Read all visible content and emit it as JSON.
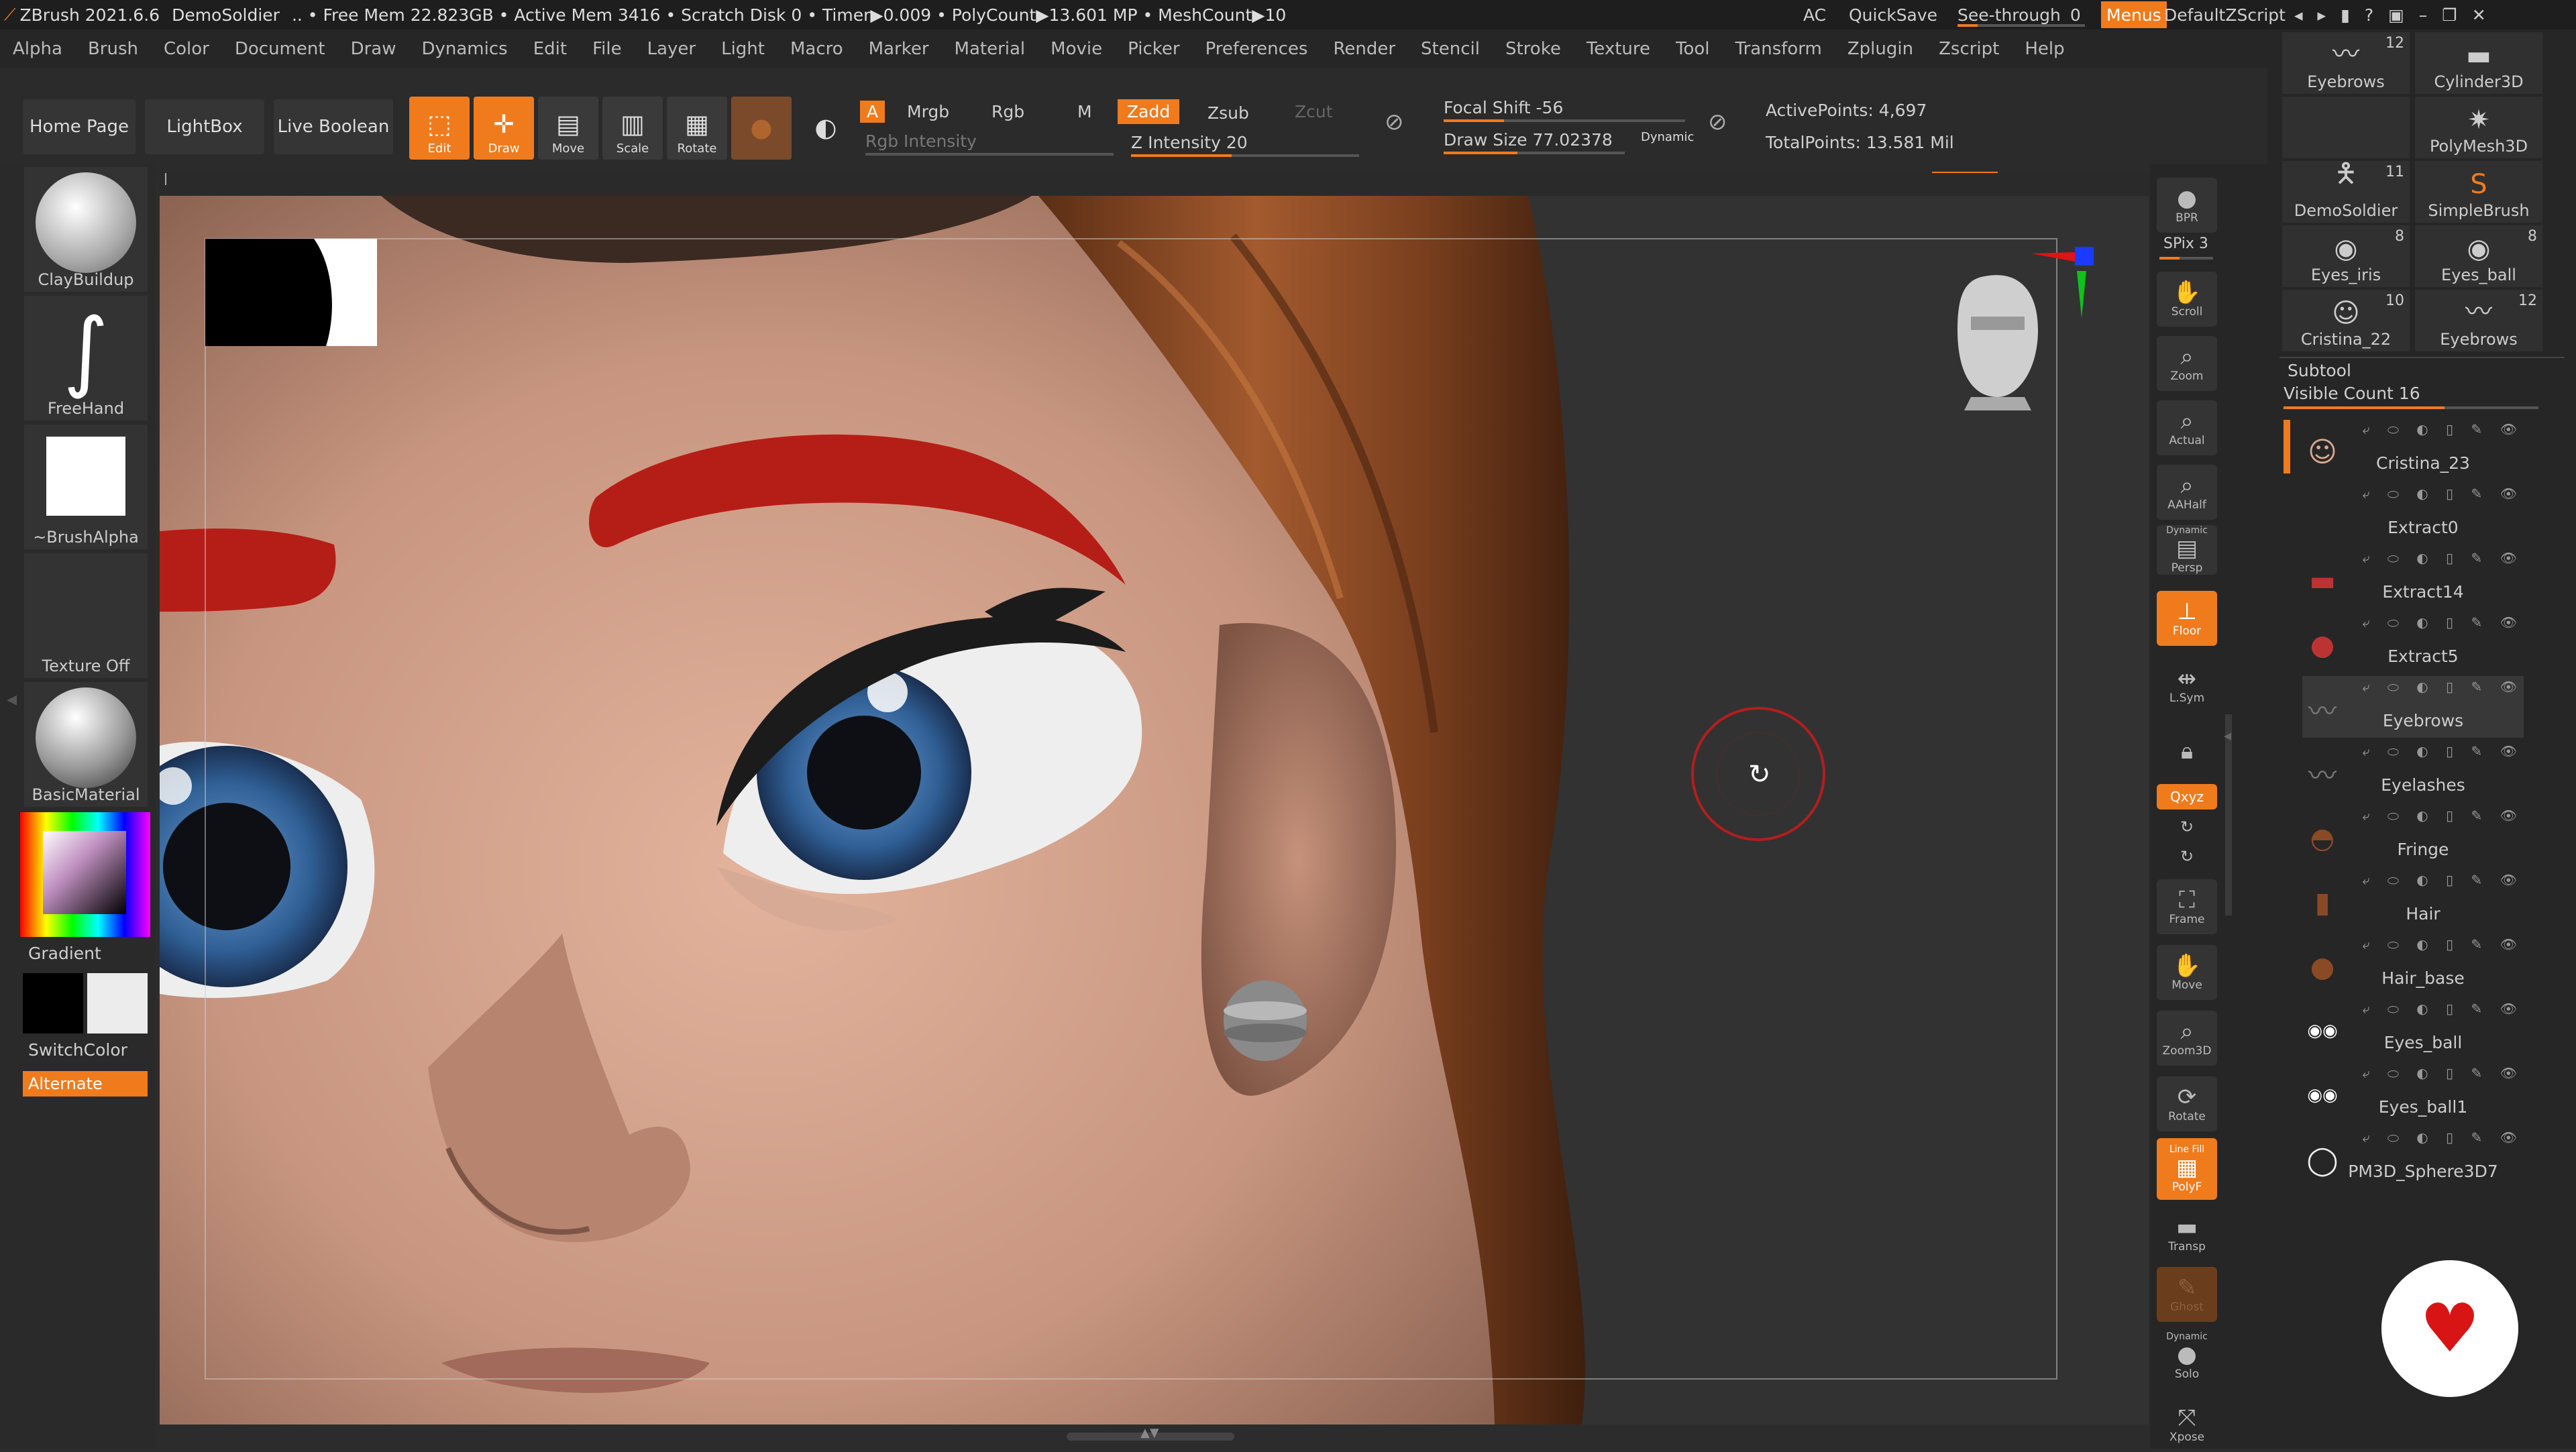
{
  "titlebar": {
    "app": "ZBrush 2021.6.6",
    "project": "DemoSoldier",
    "stats": ".. • Free Mem 22.823GB • Active Mem 3416 • Scratch Disk 0 • Timer▶0.009 • PolyCount▶13.601 MP • MeshCount▶10",
    "ac": "AC",
    "quicksave": "QuickSave",
    "see_through": "See-through",
    "see_through_value": "0",
    "menus": "Menus",
    "script": "DefaultZScript"
  },
  "menubar": [
    "Alpha",
    "Brush",
    "Color",
    "Document",
    "Draw",
    "Dynamics",
    "Edit",
    "File",
    "Layer",
    "Light",
    "Macro",
    "Marker",
    "Material",
    "Movie",
    "Picker",
    "Preferences",
    "Render",
    "Stencil",
    "Stroke",
    "Texture",
    "Tool",
    "Transform",
    "Zplugin",
    "Zscript",
    "Help"
  ],
  "shelf": {
    "home": "Home Page",
    "lightbox": "LightBox",
    "live_boolean": "Live Boolean",
    "edit": "Edit",
    "draw": "Draw",
    "move": "Move",
    "scale": "Scale",
    "rotate": "Rotate",
    "a": "A",
    "mrgb": "Mrgb",
    "rgb": "Rgb",
    "m": "M",
    "zadd": "Zadd",
    "zsub": "Zsub",
    "zcut": "Zcut",
    "rgb_intensity": "Rgb Intensity",
    "z_intensity": "Z Intensity 20",
    "focal_shift": "Focal Shift -56",
    "draw_size": "Draw Size 77.02378",
    "dynamic": "Dynamic",
    "active_points": "ActivePoints: 4,697",
    "total_points": "TotalPoints: 13.581 Mil"
  },
  "lefttray": {
    "brush": "ClayBuildup",
    "stroke": "FreeHand",
    "alpha": "~BrushAlpha",
    "texture": "Texture Off",
    "material": "BasicMaterial",
    "gradient": "Gradient",
    "switchcolor": "SwitchColor",
    "alternate": "Alternate"
  },
  "rightshelf": {
    "bpr": "BPR",
    "spix": "SPix 3",
    "scroll": "Scroll",
    "zoom": "Zoom",
    "actual": "Actual",
    "aahalf": "AAHalf",
    "dynamic_persp_top": "Dynamic",
    "persp": "Persp",
    "floor": "Floor",
    "lsym": "L.Sym",
    "xyz": "Qxyz",
    "frame": "Frame",
    "move": "Move",
    "zoom3d": "Zoom3D",
    "rotate": "Rotate",
    "line_fill": "Line Fill",
    "polyf": "PolyF",
    "transp": "Transp",
    "ghost": "Ghost",
    "dynamic_solo": "Dynamic",
    "solo": "Solo",
    "xpose": "Xpose"
  },
  "tools": [
    {
      "name": "Eyebrows",
      "count": "12"
    },
    {
      "name": "Cylinder3D",
      "count": ""
    },
    {
      "name": "",
      "count": ""
    },
    {
      "name": "PolyMesh3D",
      "count": ""
    },
    {
      "name": "DemoSoldier",
      "count": "11"
    },
    {
      "name": "SimpleBrush",
      "count": ""
    },
    {
      "name": "Eyes_iris",
      "count": "8"
    },
    {
      "name": "Eyes_ball",
      "count": "8"
    },
    {
      "name": "Cristina_22",
      "count": "10"
    },
    {
      "name": "Eyebrows",
      "count": "12"
    }
  ],
  "subtool": {
    "title": "Subtool",
    "visible_count": "Visible Count 16",
    "items": [
      "Cristina_23",
      "Extract0",
      "Extract14",
      "Extract5",
      "Eyebrows",
      "Eyelashes",
      "Fringe",
      "Hair",
      "Hair_base",
      "Eyes_ball",
      "Eyes_ball1",
      "PM3D_Sphere3D7"
    ]
  },
  "colors": {
    "accent": "#f07b1d",
    "brow": "#b51e17",
    "iris": "#3b6a9c",
    "hair": "#8a4a26",
    "skin": "#d8a88e"
  }
}
